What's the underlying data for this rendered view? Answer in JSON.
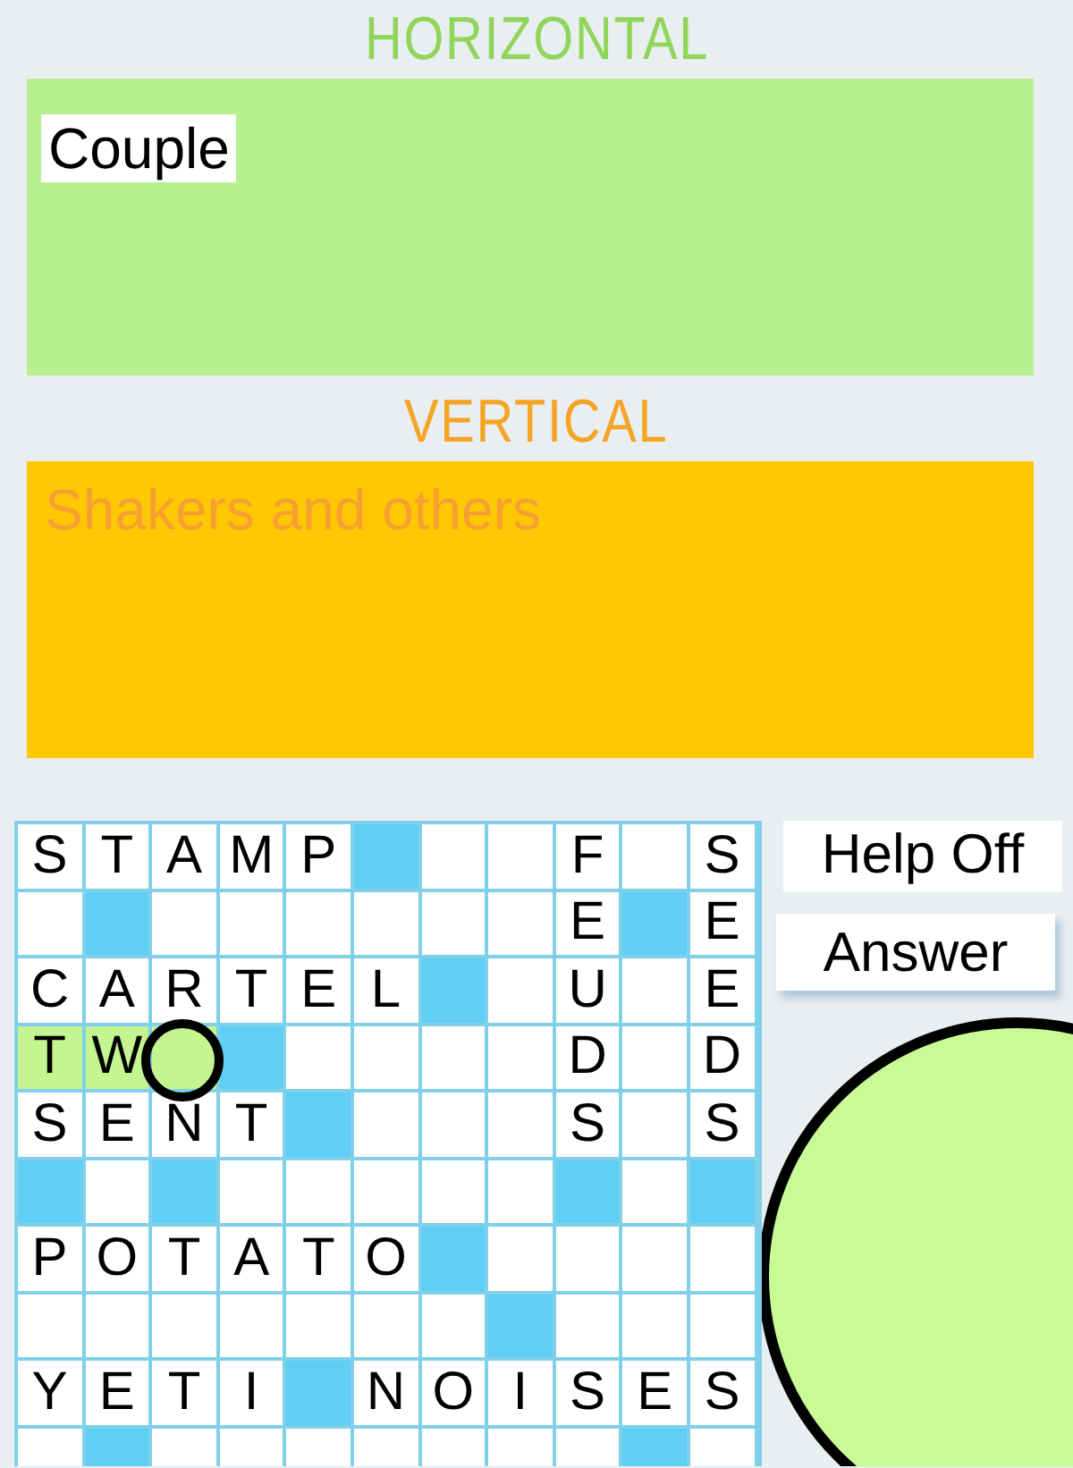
{
  "horizontal": {
    "heading": "HORIZONTAL",
    "clue": "Couple"
  },
  "vertical": {
    "heading": "VERTICAL",
    "clue": "Shakers and others"
  },
  "grid": {
    "rows": [
      {
        "cells": [
          {
            "kind": "open",
            "letter": "S",
            "highlighted": false,
            "selected": false
          },
          {
            "kind": "open",
            "letter": "T",
            "highlighted": false,
            "selected": false
          },
          {
            "kind": "open",
            "letter": "A",
            "highlighted": false,
            "selected": false
          },
          {
            "kind": "open",
            "letter": "M",
            "highlighted": false,
            "selected": false
          },
          {
            "kind": "open",
            "letter": "P",
            "highlighted": false,
            "selected": false
          },
          {
            "kind": "block"
          },
          {
            "kind": "open",
            "highlighted": false,
            "selected": false
          },
          {
            "kind": "open",
            "highlighted": false,
            "selected": false
          },
          {
            "kind": "open",
            "letter": "F",
            "highlighted": false,
            "selected": false
          },
          {
            "kind": "open",
            "highlighted": false,
            "selected": false
          },
          {
            "kind": "open",
            "letter": "S",
            "highlighted": false,
            "selected": false
          }
        ]
      },
      {
        "cells": [
          {
            "kind": "open",
            "highlighted": false,
            "selected": false
          },
          {
            "kind": "block"
          },
          {
            "kind": "open",
            "highlighted": false,
            "selected": false
          },
          {
            "kind": "open",
            "highlighted": false,
            "selected": false
          },
          {
            "kind": "open",
            "highlighted": false,
            "selected": false
          },
          {
            "kind": "open",
            "highlighted": false,
            "selected": false
          },
          {
            "kind": "open",
            "highlighted": false,
            "selected": false
          },
          {
            "kind": "open",
            "highlighted": false,
            "selected": false
          },
          {
            "kind": "open",
            "letter": "E",
            "highlighted": false,
            "selected": false
          },
          {
            "kind": "block"
          },
          {
            "kind": "open",
            "letter": "E",
            "highlighted": false,
            "selected": false
          }
        ]
      },
      {
        "cells": [
          {
            "kind": "open",
            "letter": "C",
            "highlighted": false,
            "selected": false
          },
          {
            "kind": "open",
            "letter": "A",
            "highlighted": false,
            "selected": false
          },
          {
            "kind": "open",
            "letter": "R",
            "highlighted": false,
            "selected": false
          },
          {
            "kind": "open",
            "letter": "T",
            "highlighted": false,
            "selected": false
          },
          {
            "kind": "open",
            "letter": "E",
            "highlighted": false,
            "selected": false
          },
          {
            "kind": "open",
            "letter": "L",
            "highlighted": false,
            "selected": false
          },
          {
            "kind": "block"
          },
          {
            "kind": "open",
            "highlighted": false,
            "selected": false
          },
          {
            "kind": "open",
            "letter": "U",
            "highlighted": false,
            "selected": false
          },
          {
            "kind": "open",
            "highlighted": false,
            "selected": false
          },
          {
            "kind": "open",
            "letter": "E",
            "highlighted": false,
            "selected": false
          }
        ]
      },
      {
        "cells": [
          {
            "kind": "open",
            "letter": "T",
            "highlighted": true,
            "selected": false
          },
          {
            "kind": "open",
            "letter": "W",
            "highlighted": true,
            "selected": false
          },
          {
            "kind": "open",
            "highlighted": true,
            "selected": true
          },
          {
            "kind": "block"
          },
          {
            "kind": "open",
            "highlighted": false,
            "selected": false
          },
          {
            "kind": "open",
            "highlighted": false,
            "selected": false
          },
          {
            "kind": "open",
            "highlighted": false,
            "selected": false
          },
          {
            "kind": "open",
            "highlighted": false,
            "selected": false
          },
          {
            "kind": "open",
            "letter": "D",
            "highlighted": false,
            "selected": false
          },
          {
            "kind": "open",
            "highlighted": false,
            "selected": false
          },
          {
            "kind": "open",
            "letter": "D",
            "highlighted": false,
            "selected": false
          }
        ]
      },
      {
        "cells": [
          {
            "kind": "open",
            "letter": "S",
            "highlighted": false,
            "selected": false
          },
          {
            "kind": "open",
            "letter": "E",
            "highlighted": false,
            "selected": false
          },
          {
            "kind": "open",
            "letter": "N",
            "highlighted": false,
            "selected": false
          },
          {
            "kind": "open",
            "letter": "T",
            "highlighted": false,
            "selected": false
          },
          {
            "kind": "block"
          },
          {
            "kind": "open",
            "highlighted": false,
            "selected": false
          },
          {
            "kind": "open",
            "highlighted": false,
            "selected": false
          },
          {
            "kind": "open",
            "highlighted": false,
            "selected": false
          },
          {
            "kind": "open",
            "letter": "S",
            "highlighted": false,
            "selected": false
          },
          {
            "kind": "open",
            "highlighted": false,
            "selected": false
          },
          {
            "kind": "open",
            "letter": "S",
            "highlighted": false,
            "selected": false
          }
        ]
      },
      {
        "cells": [
          {
            "kind": "block"
          },
          {
            "kind": "open",
            "highlighted": false,
            "selected": false
          },
          {
            "kind": "block"
          },
          {
            "kind": "open",
            "highlighted": false,
            "selected": false
          },
          {
            "kind": "open",
            "highlighted": false,
            "selected": false
          },
          {
            "kind": "open",
            "highlighted": false,
            "selected": false
          },
          {
            "kind": "open",
            "highlighted": false,
            "selected": false
          },
          {
            "kind": "open",
            "highlighted": false,
            "selected": false
          },
          {
            "kind": "block"
          },
          {
            "kind": "open",
            "highlighted": false,
            "selected": false
          },
          {
            "kind": "block"
          }
        ]
      },
      {
        "cells": [
          {
            "kind": "open",
            "letter": "P",
            "highlighted": false,
            "selected": false
          },
          {
            "kind": "open",
            "letter": "O",
            "highlighted": false,
            "selected": false
          },
          {
            "kind": "open",
            "letter": "T",
            "highlighted": false,
            "selected": false
          },
          {
            "kind": "open",
            "letter": "A",
            "highlighted": false,
            "selected": false
          },
          {
            "kind": "open",
            "letter": "T",
            "highlighted": false,
            "selected": false
          },
          {
            "kind": "open",
            "letter": "O",
            "highlighted": false,
            "selected": false
          },
          {
            "kind": "block"
          },
          {
            "kind": "open",
            "highlighted": false,
            "selected": false
          },
          {
            "kind": "open",
            "highlighted": false,
            "selected": false
          },
          {
            "kind": "open",
            "highlighted": false,
            "selected": false
          },
          {
            "kind": "open",
            "highlighted": false,
            "selected": false
          }
        ]
      },
      {
        "cells": [
          {
            "kind": "open",
            "highlighted": false,
            "selected": false
          },
          {
            "kind": "open",
            "highlighted": false,
            "selected": false
          },
          {
            "kind": "open",
            "highlighted": false,
            "selected": false
          },
          {
            "kind": "open",
            "highlighted": false,
            "selected": false
          },
          {
            "kind": "open",
            "highlighted": false,
            "selected": false
          },
          {
            "kind": "open",
            "highlighted": false,
            "selected": false
          },
          {
            "kind": "open",
            "highlighted": false,
            "selected": false
          },
          {
            "kind": "block"
          },
          {
            "kind": "open",
            "highlighted": false,
            "selected": false
          },
          {
            "kind": "open",
            "highlighted": false,
            "selected": false
          },
          {
            "kind": "open",
            "highlighted": false,
            "selected": false
          }
        ]
      },
      {
        "cells": [
          {
            "kind": "open",
            "letter": "Y",
            "highlighted": false,
            "selected": false
          },
          {
            "kind": "open",
            "letter": "E",
            "highlighted": false,
            "selected": false
          },
          {
            "kind": "open",
            "letter": "T",
            "highlighted": false,
            "selected": false
          },
          {
            "kind": "open",
            "letter": "I",
            "highlighted": false,
            "selected": false
          },
          {
            "kind": "block"
          },
          {
            "kind": "open",
            "letter": "N",
            "highlighted": false,
            "selected": false
          },
          {
            "kind": "open",
            "letter": "O",
            "highlighted": false,
            "selected": false
          },
          {
            "kind": "open",
            "letter": "I",
            "highlighted": false,
            "selected": false
          },
          {
            "kind": "open",
            "letter": "S",
            "highlighted": false,
            "selected": false
          },
          {
            "kind": "open",
            "letter": "E",
            "highlighted": false,
            "selected": false
          },
          {
            "kind": "open",
            "letter": "S",
            "highlighted": false,
            "selected": false
          }
        ]
      },
      {
        "cells": [
          {
            "kind": "open",
            "highlighted": false,
            "selected": false
          },
          {
            "kind": "block"
          },
          {
            "kind": "open",
            "highlighted": false,
            "selected": false
          },
          {
            "kind": "open",
            "highlighted": false,
            "selected": false
          },
          {
            "kind": "open",
            "highlighted": false,
            "selected": false
          },
          {
            "kind": "open",
            "highlighted": false,
            "selected": false
          },
          {
            "kind": "open",
            "highlighted": false,
            "selected": false
          },
          {
            "kind": "open",
            "highlighted": false,
            "selected": false
          },
          {
            "kind": "open",
            "highlighted": false,
            "selected": false
          },
          {
            "kind": "block"
          },
          {
            "kind": "open",
            "highlighted": false,
            "selected": false
          }
        ]
      }
    ]
  },
  "buttons": [
    {
      "label": "Help Off"
    },
    {
      "label": "Answer"
    }
  ]
}
